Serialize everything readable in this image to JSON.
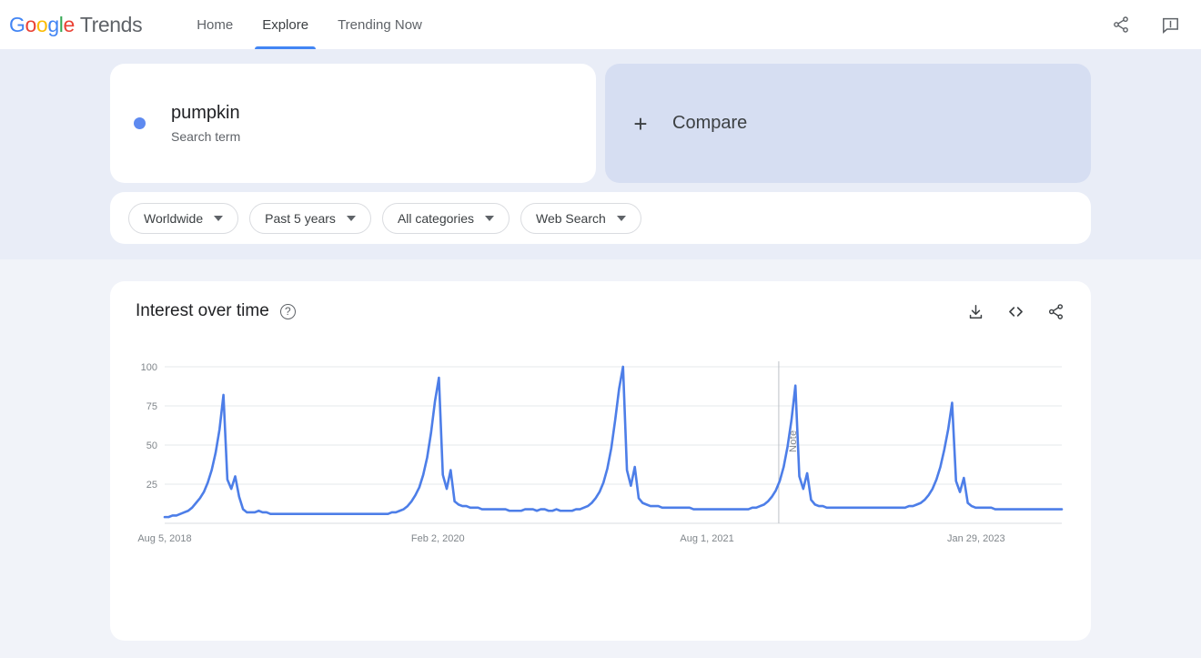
{
  "header": {
    "logo": {
      "g1": "G",
      "o1": "o",
      "o2": "o",
      "g2": "g",
      "l1": "l",
      "e1": "e",
      "word": "Trends"
    },
    "nav": [
      {
        "label": "Home",
        "active": false
      },
      {
        "label": "Explore",
        "active": true
      },
      {
        "label": "Trending Now",
        "active": false
      }
    ],
    "share_icon": "share-icon",
    "feedback_icon": "feedback-icon"
  },
  "query": {
    "term": "pumpkin",
    "type_label": "Search term",
    "dot_color": "#5E8AF0"
  },
  "compare": {
    "plus": "+",
    "label": "Compare"
  },
  "filters": [
    {
      "label": "Worldwide"
    },
    {
      "label": "Past 5 years"
    },
    {
      "label": "All categories"
    },
    {
      "label": "Web Search"
    }
  ],
  "chart_card": {
    "title": "Interest over time",
    "help": "?",
    "tools": [
      {
        "name": "download-icon"
      },
      {
        "name": "embed-icon",
        "glyph": "<  >"
      },
      {
        "name": "share-icon"
      }
    ]
  },
  "chart_data": {
    "type": "line",
    "title": "Interest over time",
    "xlabel": "",
    "ylabel": "",
    "ylim": [
      0,
      100
    ],
    "yticks": [
      25,
      50,
      75,
      100
    ],
    "grid": true,
    "legend": false,
    "line_color": "#4D7EE8",
    "x_tick_labels": [
      "Aug 5, 2018",
      "Feb 2, 2020",
      "Aug 1, 2021",
      "Jan 29, 2023"
    ],
    "x_tick_positions": [
      0,
      0.3045,
      0.6045,
      0.9045
    ],
    "annotations": [
      {
        "label": "Note",
        "x": 0.6845
      }
    ],
    "series": [
      {
        "name": "pumpkin",
        "values": [
          4,
          4,
          5,
          5,
          6,
          7,
          8,
          10,
          13,
          16,
          20,
          26,
          34,
          45,
          60,
          82,
          28,
          22,
          30,
          17,
          9,
          7,
          7,
          7,
          8,
          7,
          7,
          6,
          6,
          6,
          6,
          6,
          6,
          6,
          6,
          6,
          6,
          6,
          6,
          6,
          6,
          6,
          6,
          6,
          6,
          6,
          6,
          6,
          6,
          6,
          6,
          6,
          6,
          6,
          6,
          6,
          6,
          6,
          7,
          7,
          8,
          9,
          11,
          14,
          18,
          23,
          31,
          42,
          58,
          78,
          93,
          31,
          22,
          34,
          14,
          12,
          11,
          11,
          10,
          10,
          10,
          9,
          9,
          9,
          9,
          9,
          9,
          9,
          8,
          8,
          8,
          8,
          9,
          9,
          9,
          8,
          9,
          9,
          8,
          8,
          9,
          8,
          8,
          8,
          8,
          9,
          9,
          10,
          11,
          13,
          16,
          20,
          26,
          35,
          48,
          66,
          86,
          100,
          34,
          24,
          36,
          16,
          13,
          12,
          11,
          11,
          11,
          10,
          10,
          10,
          10,
          10,
          10,
          10,
          10,
          9,
          9,
          9,
          9,
          9,
          9,
          9,
          9,
          9,
          9,
          9,
          9,
          9,
          9,
          9,
          10,
          10,
          11,
          12,
          14,
          17,
          21,
          27,
          36,
          49,
          66,
          88,
          30,
          22,
          32,
          15,
          12,
          11,
          11,
          10,
          10,
          10,
          10,
          10,
          10,
          10,
          10,
          10,
          10,
          10,
          10,
          10,
          10,
          10,
          10,
          10,
          10,
          10,
          10,
          10,
          11,
          11,
          12,
          13,
          15,
          18,
          22,
          28,
          36,
          47,
          60,
          77,
          27,
          20,
          29,
          13,
          11,
          10,
          10,
          10,
          10,
          10,
          9,
          9,
          9,
          9,
          9,
          9,
          9,
          9,
          9,
          9,
          9,
          9,
          9,
          9,
          9,
          9,
          9,
          9
        ]
      }
    ]
  }
}
